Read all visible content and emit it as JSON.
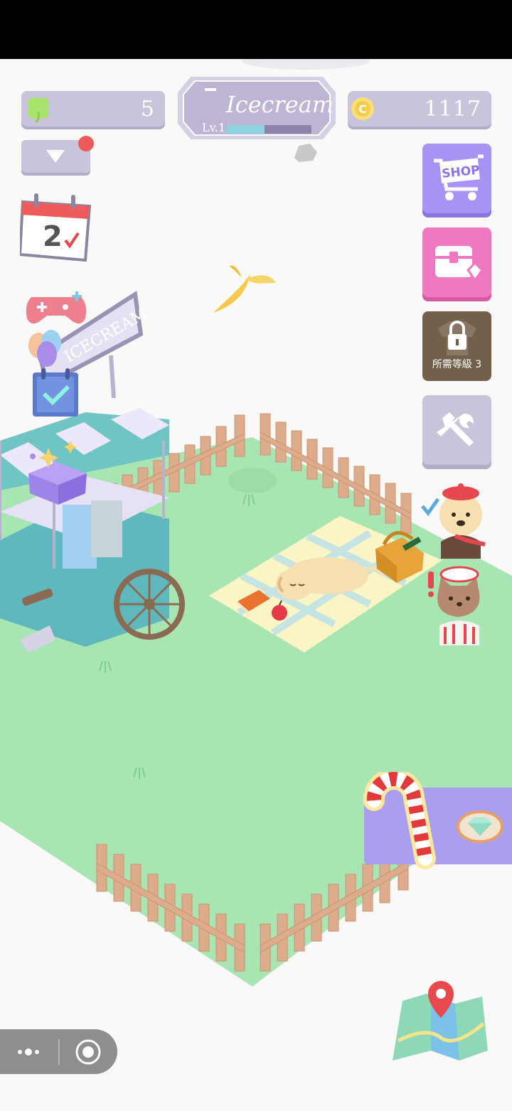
{
  "hud": {
    "clover_count": "5",
    "coin_count": "1117",
    "shop_name": "Icecream",
    "level_label": "Lv.1",
    "level_progress": 0.45
  },
  "side_buttons": {
    "shop_label": "SHOP",
    "locked_label": "所需等級 3"
  },
  "calendar": {
    "day": "2"
  },
  "cart_sign": "ICECREAM",
  "icons": [
    "clover-icon",
    "coin-icon",
    "dropdown-arrow-icon",
    "calendar-icon",
    "gamepad-icon",
    "balloons-icon",
    "task-clipboard-icon",
    "mystery-box-icon",
    "shop-cart-icon",
    "chest-icon",
    "lock-icon",
    "tools-icon",
    "map-icon",
    "gem-icon",
    "candy-cane-icon",
    "banana-peel-icon"
  ],
  "colors": {
    "grass": "#a8e5b3",
    "panel": "#c9c3dc",
    "shop": "#a892f5",
    "chest": "#ef78c0",
    "locked": "#73604a"
  }
}
